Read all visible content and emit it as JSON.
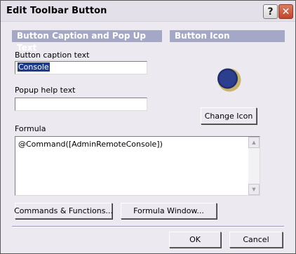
{
  "window": {
    "title": "Edit Toolbar Button"
  },
  "titlebar": {
    "help_glyph": "?",
    "close_glyph": "✕"
  },
  "caption_section": {
    "header": "Button Caption and Pop Up Text",
    "caption_label": "Button caption text",
    "caption_value": "Console",
    "popup_label": "Popup help text",
    "popup_value": ""
  },
  "icon_section": {
    "header": "Button Icon",
    "icon": "blue-circle-icon",
    "change_label": "Change Icon",
    "colors": {
      "fill": "#2c3f8f",
      "ring": "#c9b56a"
    }
  },
  "formula": {
    "label": "Formula",
    "value": "@Command([AdminRemoteConsole])"
  },
  "buttons": {
    "commands_functions": "Commands & Functions...",
    "formula_window": "Formula Window...",
    "ok": "OK",
    "cancel": "Cancel"
  },
  "colors": {
    "section_header": "#a4a8c6",
    "dialog_bg": "#ece9f0"
  }
}
